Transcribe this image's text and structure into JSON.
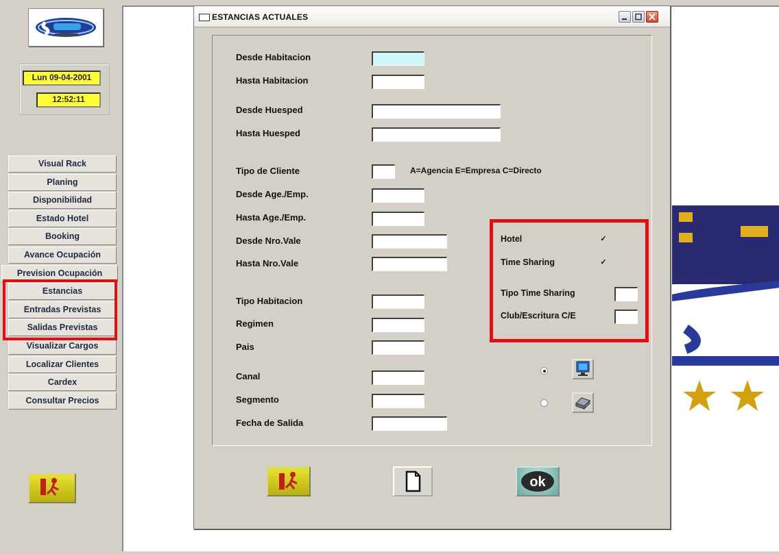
{
  "app": {
    "date": "Lun 09-04-2001",
    "time": "12:52:11"
  },
  "menu": {
    "items": [
      {
        "label": "Visual Rack"
      },
      {
        "label": "Planing"
      },
      {
        "label": "Disponibilidad"
      },
      {
        "label": "Estado Hotel"
      },
      {
        "label": "Booking"
      },
      {
        "label": "Avance Ocupación"
      },
      {
        "label": "Prevision Ocupación"
      },
      {
        "label": "Estancias"
      },
      {
        "label": "Entradas  Previstas"
      },
      {
        "label": "Salidas  Previstas"
      },
      {
        "label": "Visualizar Cargos"
      },
      {
        "label": "Localizar Clientes"
      },
      {
        "label": "Cardex"
      },
      {
        "label": "Consultar Precios"
      }
    ]
  },
  "dialog": {
    "title": "ESTANCIAS ACTUALES",
    "fields": {
      "desde_habitacion": {
        "label": "Desde Habitacion",
        "value": ""
      },
      "hasta_habitacion": {
        "label": "Hasta Habitacion",
        "value": ""
      },
      "desde_huesped": {
        "label": "Desde Huesped",
        "value": ""
      },
      "hasta_huesped": {
        "label": "Hasta Huesped",
        "value": ""
      },
      "tipo_cliente": {
        "label": "Tipo de Cliente",
        "value": "",
        "hint": "A=Agencia  E=Empresa  C=Directo"
      },
      "desde_age_emp": {
        "label": "Desde Age./Emp.",
        "value": ""
      },
      "hasta_age_emp": {
        "label": "Hasta Age./Emp.",
        "value": ""
      },
      "desde_nro_vale": {
        "label": "Desde Nro.Vale",
        "value": ""
      },
      "hasta_nro_vale": {
        "label": "Hasta Nro.Vale",
        "value": ""
      },
      "tipo_habitacion": {
        "label": "Tipo Habitacion",
        "value": ""
      },
      "regimen": {
        "label": "Regimen",
        "value": ""
      },
      "pais": {
        "label": "Pais",
        "value": ""
      },
      "canal": {
        "label": "Canal",
        "value": ""
      },
      "segmento": {
        "label": "Segmento",
        "value": ""
      },
      "fecha_salida": {
        "label": "Fecha de Salida",
        "value": ""
      }
    },
    "options": {
      "hotel": {
        "label": "Hotel",
        "checked": true
      },
      "time_sharing": {
        "label": "Time Sharing",
        "checked": true
      },
      "tipo_time_sharing": {
        "label": "Tipo Time Sharing",
        "value": ""
      },
      "club_escritura": {
        "label": "Club/Escritura C/E",
        "value": ""
      }
    },
    "output": {
      "screen_selected": true,
      "printer_selected": false,
      "screen_icon": "monitor-icon",
      "printer_icon": "printer-icon"
    },
    "buttons": {
      "exit_icon": "exit-door-icon",
      "new_icon": "blank-document-icon",
      "ok_label": "ok"
    }
  },
  "colors": {
    "highlight": "#e01010",
    "clock_bg": "#ffff33",
    "active_field": "#cdf7f8"
  }
}
